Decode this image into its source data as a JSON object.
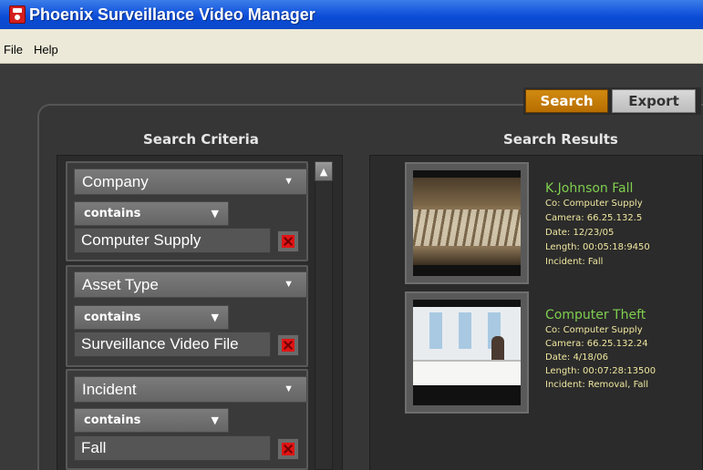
{
  "window": {
    "title": "Phoenix Surveillance Video Manager"
  },
  "menu": {
    "items": [
      "File",
      "Help"
    ]
  },
  "tabs": {
    "search": "Search",
    "export": "Export"
  },
  "headings": {
    "criteria": "Search Criteria",
    "results": "Search Results"
  },
  "criteria": [
    {
      "field": "Company",
      "operator": "contains",
      "value": "Computer Supply"
    },
    {
      "field": "Asset Type",
      "operator": "contains",
      "value": "Surveillance Video File"
    },
    {
      "field": "Incident",
      "operator": "contains",
      "value": "Fall"
    }
  ],
  "results": [
    {
      "title": "K.Johnson Fall",
      "company": "Co: Computer Supply",
      "camera": "Camera: 66.25.132.5",
      "date": "Date: 12/23/05",
      "length": "Length: 00:05:18:9450",
      "incident": "Incident: Fall"
    },
    {
      "title": "Computer Theft",
      "company": "Co: Computer Supply",
      "camera": "Camera: 66.25.132.24",
      "date": "Date: 4/18/06",
      "length": "Length: 00:07:28:13500",
      "incident": "Incident: Removal, Fall"
    }
  ],
  "colors": {
    "active_tab": "#c47c08",
    "result_title": "#7fcf4e",
    "result_detail": "#f0e8a0"
  },
  "icons": {
    "dropdown": "chevron-down-icon",
    "delete": "delete-icon",
    "scroll_up": "scroll-up-arrow-icon"
  }
}
